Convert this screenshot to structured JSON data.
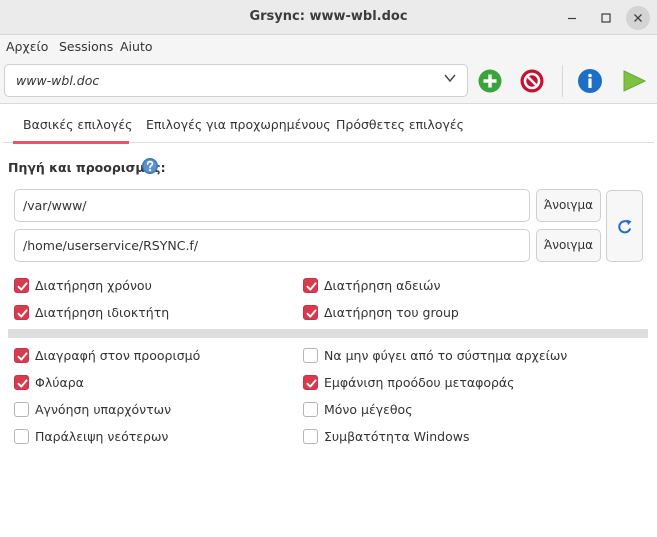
{
  "window": {
    "title": "Grsync: www-wbl.doc"
  },
  "menu": {
    "items": [
      "Αρχείο",
      "Sessions",
      "Aiuto"
    ]
  },
  "toolbar": {
    "session_value": "www-wbl.doc"
  },
  "tabs": [
    "Βασικές επιλογές",
    "Επιλογές για προχωρημένους",
    "Πρόσθετες επιλογές"
  ],
  "section": {
    "label": "Πηγή και προορισμός:"
  },
  "paths": {
    "source": "/var/www/",
    "destination": "/home/userservice/RSYNC.f/"
  },
  "buttons": {
    "open_label": "Άνοιγμα"
  },
  "options": [
    {
      "label": "Διατήρηση χρόνου",
      "checked": true
    },
    {
      "label": "Διατήρηση αδειών",
      "checked": true
    },
    {
      "label": "Διατήρηση ιδιοκτήτη",
      "checked": true
    },
    {
      "label": "Διατήρηση του group",
      "checked": true
    },
    {
      "label": "Διαγραφή στον προορισμό",
      "checked": true
    },
    {
      "label": "Να μην φύγει από το σύστημα αρχείων",
      "checked": false
    },
    {
      "label": "Φλύαρα",
      "checked": true
    },
    {
      "label": "Εμφάνιση προόδου μεταφοράς",
      "checked": true
    },
    {
      "label": "Αγνόηση υπαρχόντων",
      "checked": false
    },
    {
      "label": "Μόνο μέγεθος",
      "checked": false
    },
    {
      "label": "Παράλειψη νεότερων",
      "checked": false
    },
    {
      "label": "Συμβατότητα Windows",
      "checked": false
    }
  ],
  "icons": {
    "add": "plus-circle-icon",
    "delete": "stop-circle-icon",
    "info": "info-icon",
    "run": "play-icon",
    "help": "help-icon",
    "refresh": "refresh-icon"
  },
  "colors": {
    "accent": "#d83a4e",
    "add_green": "#3ba33b",
    "delete_red": "#c8102e",
    "info_blue": "#1c6fc4",
    "run_green": "#7ec242"
  }
}
